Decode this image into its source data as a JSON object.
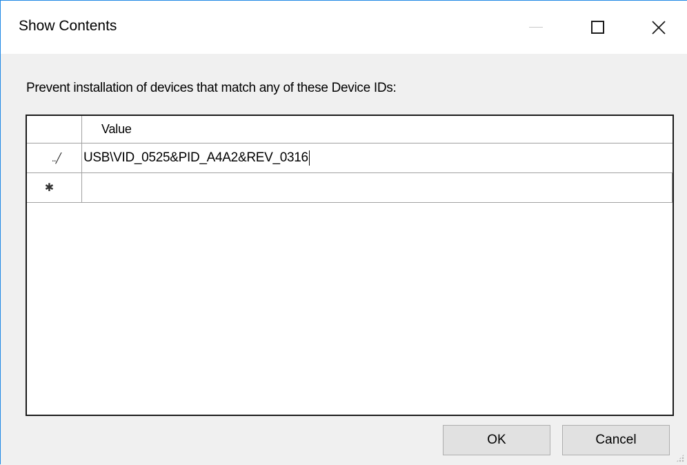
{
  "window": {
    "title": "Show Contents"
  },
  "dialog": {
    "prompt": "Prevent installation of devices that match any of these Device IDs:"
  },
  "grid": {
    "column_header": "Value",
    "rows": [
      {
        "indicator": "edit-pencil-icon",
        "value": "USB\\VID_0525&PID_A4A2&REV_0316"
      },
      {
        "indicator": "new-row-asterisk-icon",
        "value": ""
      }
    ]
  },
  "buttons": {
    "ok": "OK",
    "cancel": "Cancel"
  }
}
